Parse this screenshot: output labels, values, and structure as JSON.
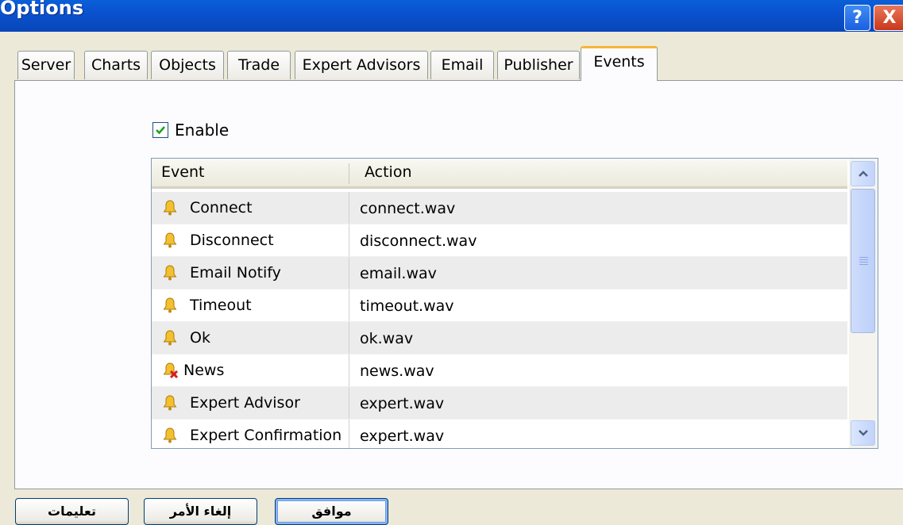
{
  "window": {
    "title": "Options",
    "help_glyph": "?",
    "close_glyph": "X"
  },
  "tabs": [
    {
      "label": "Server"
    },
    {
      "label": "Charts"
    },
    {
      "label": "Objects"
    },
    {
      "label": "Trade"
    },
    {
      "label": "Expert Advisors"
    },
    {
      "label": "Email"
    },
    {
      "label": "Publisher"
    },
    {
      "label": "Events",
      "active": true
    }
  ],
  "enable": {
    "label": "Enable",
    "checked": true
  },
  "events_table": {
    "columns": [
      "Event",
      "Action"
    ],
    "rows": [
      {
        "event": "Connect",
        "action": "connect.wav",
        "icon": "bell-icon"
      },
      {
        "event": "Disconnect",
        "action": "disconnect.wav",
        "icon": "bell-icon"
      },
      {
        "event": "Email Notify",
        "action": "email.wav",
        "icon": "bell-icon"
      },
      {
        "event": "Timeout",
        "action": "timeout.wav",
        "icon": "bell-icon"
      },
      {
        "event": "Ok",
        "action": "ok.wav",
        "icon": "bell-icon"
      },
      {
        "event": "News",
        "action": "news.wav",
        "icon": "bell-disabled-icon"
      },
      {
        "event": "Expert Advisor",
        "action": "expert.wav",
        "icon": "bell-icon"
      },
      {
        "event": "Expert Confirmation",
        "action": "expert.wav",
        "icon": "bell-icon"
      }
    ]
  },
  "buttons": {
    "ok": "موافق",
    "cancel": "إلغاء الأمر",
    "help": "تعليمات"
  },
  "colors": {
    "titlebar": "#0a52cf",
    "dialog_bg": "#ece9d8",
    "active_tab_accent": "#f5b636",
    "checkbox_check": "#21a121",
    "bell": "#f2c12e"
  }
}
